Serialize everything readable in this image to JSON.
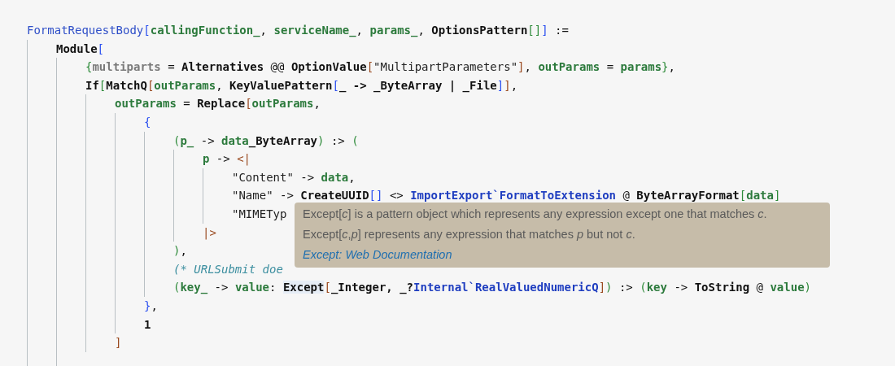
{
  "code": {
    "lines": [
      {
        "tokens": [
          {
            "t": "FormatRequestBody",
            "kind": "fn"
          },
          {
            "t": "[",
            "kind": "br1"
          },
          {
            "t": "callingFunction_",
            "kind": "var"
          },
          {
            "t": ", ",
            "kind": "op"
          },
          {
            "t": "serviceName_",
            "kind": "var"
          },
          {
            "t": ", ",
            "kind": "op"
          },
          {
            "t": "params_",
            "kind": "var"
          },
          {
            "t": ", ",
            "kind": "op"
          },
          {
            "t": "OptionsPattern",
            "kind": "sym"
          },
          {
            "t": "[]",
            "kind": "br3"
          },
          {
            "t": "]",
            "kind": "br1"
          },
          {
            "t": " :=",
            "kind": "op"
          }
        ],
        "children": [
          {
            "tokens": [
              {
                "t": "Module",
                "kind": "sym"
              },
              {
                "t": "[",
                "kind": "br1"
              }
            ],
            "children": [
              {
                "tokens": [
                  {
                    "t": "{",
                    "kind": "br3"
                  },
                  {
                    "t": "multiparts",
                    "kind": "local"
                  },
                  {
                    "t": " = ",
                    "kind": "op"
                  },
                  {
                    "t": "Alternatives",
                    "kind": "sym"
                  },
                  {
                    "t": " @@ ",
                    "kind": "op"
                  },
                  {
                    "t": "OptionValue",
                    "kind": "sym"
                  },
                  {
                    "t": "[",
                    "kind": "br2"
                  },
                  {
                    "t": "\"MultipartParameters\"",
                    "kind": "str"
                  },
                  {
                    "t": "]",
                    "kind": "br2"
                  },
                  {
                    "t": ", ",
                    "kind": "op"
                  },
                  {
                    "t": "outParams",
                    "kind": "var"
                  },
                  {
                    "t": " = ",
                    "kind": "op"
                  },
                  {
                    "t": "params",
                    "kind": "var"
                  },
                  {
                    "t": "}",
                    "kind": "br3"
                  },
                  {
                    "t": ",",
                    "kind": "op"
                  }
                ]
              },
              {
                "tokens": [
                  {
                    "t": "If",
                    "kind": "sym"
                  },
                  {
                    "t": "[",
                    "kind": "br3"
                  },
                  {
                    "t": "MatchQ",
                    "kind": "sym"
                  },
                  {
                    "t": "[",
                    "kind": "br2"
                  },
                  {
                    "t": "outParams",
                    "kind": "var"
                  },
                  {
                    "t": ", ",
                    "kind": "op"
                  },
                  {
                    "t": "KeyValuePattern",
                    "kind": "sym"
                  },
                  {
                    "t": "[",
                    "kind": "br1"
                  },
                  {
                    "t": "_ -> _ByteArray | _File",
                    "kind": "sym"
                  },
                  {
                    "t": "]",
                    "kind": "br1"
                  },
                  {
                    "t": "]",
                    "kind": "br2"
                  },
                  {
                    "t": ",",
                    "kind": "op"
                  }
                ],
                "children": [
                  {
                    "tokens": [
                      {
                        "t": "outParams",
                        "kind": "var"
                      },
                      {
                        "t": " = ",
                        "kind": "op"
                      },
                      {
                        "t": "Replace",
                        "kind": "sym"
                      },
                      {
                        "t": "[",
                        "kind": "br2"
                      },
                      {
                        "t": "outParams",
                        "kind": "var"
                      },
                      {
                        "t": ",",
                        "kind": "op"
                      }
                    ],
                    "children": [
                      {
                        "tokens": [
                          {
                            "t": "{",
                            "kind": "br1"
                          }
                        ],
                        "children": [
                          {
                            "tokens": [
                              {
                                "t": "(",
                                "kind": "br3"
                              },
                              {
                                "t": "p_",
                                "kind": "var"
                              },
                              {
                                "t": " -> ",
                                "kind": "op"
                              },
                              {
                                "t": "data",
                                "kind": "var"
                              },
                              {
                                "t": "_ByteArray",
                                "kind": "sym"
                              },
                              {
                                "t": ")",
                                "kind": "br3"
                              },
                              {
                                "t": " :> ",
                                "kind": "op"
                              },
                              {
                                "t": "(",
                                "kind": "br3"
                              }
                            ],
                            "children": [
                              {
                                "tokens": [
                                  {
                                    "t": "p",
                                    "kind": "var"
                                  },
                                  {
                                    "t": " -> ",
                                    "kind": "op"
                                  },
                                  {
                                    "t": "<|",
                                    "kind": "br2"
                                  }
                                ],
                                "children": [
                                  {
                                    "tokens": [
                                      {
                                        "t": "\"Content\"",
                                        "kind": "str"
                                      },
                                      {
                                        "t": " -> ",
                                        "kind": "op"
                                      },
                                      {
                                        "t": "data",
                                        "kind": "var"
                                      },
                                      {
                                        "t": ",",
                                        "kind": "op"
                                      }
                                    ]
                                  },
                                  {
                                    "tokens": [
                                      {
                                        "t": "\"Name\"",
                                        "kind": "str"
                                      },
                                      {
                                        "t": " -> ",
                                        "kind": "op"
                                      },
                                      {
                                        "t": "CreateUUID",
                                        "kind": "sym"
                                      },
                                      {
                                        "t": "[]",
                                        "kind": "br1"
                                      },
                                      {
                                        "t": " <> ",
                                        "kind": "op"
                                      },
                                      {
                                        "t": "ImportExport`FormatToExtension",
                                        "kind": "ctx"
                                      },
                                      {
                                        "t": " @ ",
                                        "kind": "op"
                                      },
                                      {
                                        "t": "ByteArrayFormat",
                                        "kind": "sym"
                                      },
                                      {
                                        "t": "[",
                                        "kind": "br3"
                                      },
                                      {
                                        "t": "data",
                                        "kind": "var"
                                      },
                                      {
                                        "t": "]",
                                        "kind": "br3"
                                      }
                                    ]
                                  },
                                  {
                                    "tokens": [
                                      {
                                        "t": "\"MIMETyp",
                                        "kind": "str"
                                      }
                                    ]
                                  }
                                ]
                              },
                              {
                                "tokens": [
                                  {
                                    "t": "|>",
                                    "kind": "br2"
                                  }
                                ]
                              }
                            ]
                          },
                          {
                            "tokens": [
                              {
                                "t": ")",
                                "kind": "br3"
                              },
                              {
                                "t": ",",
                                "kind": "op"
                              }
                            ]
                          },
                          {
                            "tokens": [
                              {
                                "t": "(* URLSubmit doe",
                                "kind": "comment"
                              }
                            ]
                          },
                          {
                            "tokens": [
                              {
                                "t": "(",
                                "kind": "br3"
                              },
                              {
                                "t": "key_",
                                "kind": "var"
                              },
                              {
                                "t": " -> ",
                                "kind": "op"
                              },
                              {
                                "t": "value",
                                "kind": "var"
                              },
                              {
                                "t": ": ",
                                "kind": "op"
                              },
                              {
                                "t": "Except",
                                "kind": "hl"
                              },
                              {
                                "t": "[",
                                "kind": "br2"
                              },
                              {
                                "t": "_Integer, _?",
                                "kind": "sym"
                              },
                              {
                                "t": "Internal`RealValuedNumericQ",
                                "kind": "ctx"
                              },
                              {
                                "t": "]",
                                "kind": "br2"
                              },
                              {
                                "t": ")",
                                "kind": "br3"
                              },
                              {
                                "t": " :> ",
                                "kind": "op"
                              },
                              {
                                "t": "(",
                                "kind": "br3"
                              },
                              {
                                "t": "key",
                                "kind": "var"
                              },
                              {
                                "t": " -> ",
                                "kind": "op"
                              },
                              {
                                "t": "ToString",
                                "kind": "sym"
                              },
                              {
                                "t": " @ ",
                                "kind": "op"
                              },
                              {
                                "t": "value",
                                "kind": "var"
                              },
                              {
                                "t": ")",
                                "kind": "br3"
                              }
                            ]
                          }
                        ]
                      },
                      {
                        "tokens": [
                          {
                            "t": "}",
                            "kind": "br1"
                          },
                          {
                            "t": ",",
                            "kind": "op"
                          }
                        ]
                      },
                      {
                        "tokens": [
                          {
                            "t": "1",
                            "kind": "sym"
                          }
                        ]
                      }
                    ]
                  },
                  {
                    "tokens": [
                      {
                        "t": "]",
                        "kind": "br2"
                      }
                    ]
                  }
                ]
              }
            ]
          }
        ]
      }
    ]
  },
  "tooltip": {
    "lines": [
      "Except[*c*] is a pattern object which represents any expression except one that matches *c*.",
      "Except[*c*,*p*] represents any expression that matches *p* but not *c*."
    ],
    "link": "Except: Web Documentation"
  }
}
